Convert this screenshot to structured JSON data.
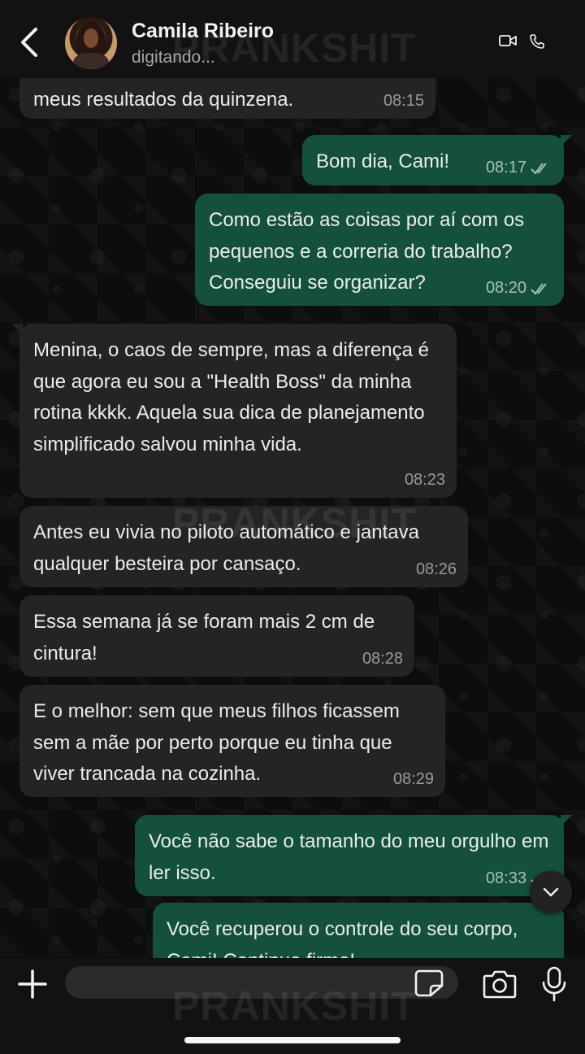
{
  "header": {
    "contact_name": "Camila Ribeiro",
    "status": "digitando..."
  },
  "watermark": "PRANKSHIT",
  "messages": [
    {
      "dir": "in",
      "text": "meus resultados da quinzena.",
      "time": "08:15"
    },
    {
      "dir": "out",
      "text": "Bom dia, Cami!",
      "time": "08:17"
    },
    {
      "dir": "out",
      "text": "Como estão as coisas por aí com os pequenos e a correria do trabalho? Conseguiu se organizar?",
      "time": "08:20"
    },
    {
      "dir": "in",
      "text": "Menina, o caos de sempre, mas a diferença é que agora eu sou a \"Health Boss\" da minha rotina kkkk. Aquela sua dica de planejamento simplificado salvou minha vida.",
      "time": "08:23"
    },
    {
      "dir": "in",
      "text": "Antes eu vivia no piloto automático e jantava qualquer besteira por cansaço.",
      "time": "08:26"
    },
    {
      "dir": "in",
      "text": "Essa semana já se foram mais 2 cm de cintura!",
      "time": "08:28"
    },
    {
      "dir": "in",
      "text": "E o melhor: sem que meus filhos ficassem sem a mãe por perto porque eu tinha que viver trancada na cozinha.",
      "time": "08:29"
    },
    {
      "dir": "out",
      "text": "Você não sabe o tamanho do meu orgulho em ler isso.",
      "time": "08:33"
    },
    {
      "dir": "out",
      "text": "Você recuperou o controle do seu corpo, Cami! Continue firme!",
      "time": ""
    }
  ],
  "composer": {
    "placeholder": ""
  },
  "icons": {
    "back": "chevron-left-icon",
    "video": "video-camera-icon",
    "call": "phone-icon",
    "plus": "plus-icon",
    "sticker": "sticker-icon",
    "camera": "camera-icon",
    "mic": "microphone-icon",
    "scroll": "chevron-down-icon"
  },
  "colors": {
    "incoming_bubble": "#242424",
    "outgoing_bubble": "#14503d",
    "background": "#0d0d0d"
  }
}
